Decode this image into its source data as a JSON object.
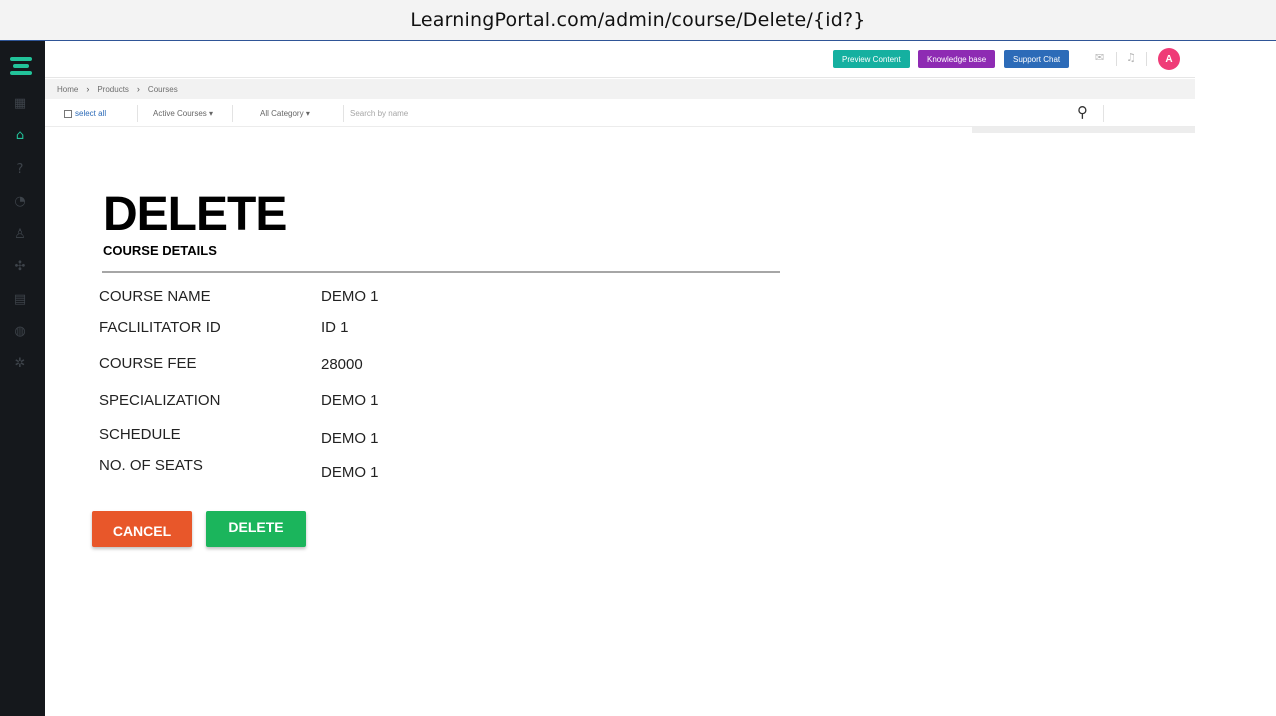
{
  "browser": {
    "url": "LearningPortal.com/admin/course/Delete/{id?}"
  },
  "header": {
    "preview_label": "Preview Content",
    "kb_label": "Knowledge base",
    "support_label": "Support Chat",
    "avatar_initial": "A",
    "colors": {
      "preview": "#15b0a0",
      "kb": "#8e2bb3",
      "support": "#2c6bb8",
      "avatar": "#ef3b77"
    }
  },
  "sidebar": {
    "accent": "#22c39a",
    "icons": [
      "dashboard-icon",
      "graduation-cap-icon",
      "help-icon",
      "chart-icon",
      "users-icon",
      "puzzle-icon",
      "clipboard-icon",
      "globe-icon",
      "settings-icon"
    ]
  },
  "breadcrumb": [
    "Home",
    "Products",
    "Courses"
  ],
  "filters": {
    "select_all": "select all",
    "active_courses": "Active Courses",
    "all_category": "All Category",
    "search_placeholder": "Search by name"
  },
  "page": {
    "title": "DELETE",
    "subtitle": "COURSE DETAILS"
  },
  "fields": [
    {
      "label": "COURSE NAME",
      "value": "DEMO 1"
    },
    {
      "label": "FACLILITATOR ID",
      "value": "ID 1"
    },
    {
      "label": "COURSE FEE",
      "value": "28000"
    },
    {
      "label": "SPECIALIZATION",
      "value": "DEMO 1"
    },
    {
      "label": "SCHEDULE",
      "value": "DEMO 1"
    },
    {
      "label": "NO. OF SEATS",
      "value": "DEMO 1"
    }
  ],
  "actions": {
    "cancel_label": "CANCEL",
    "delete_label": "DELETE",
    "colors": {
      "cancel": "#e8572a",
      "delete": "#1bb55c"
    }
  }
}
